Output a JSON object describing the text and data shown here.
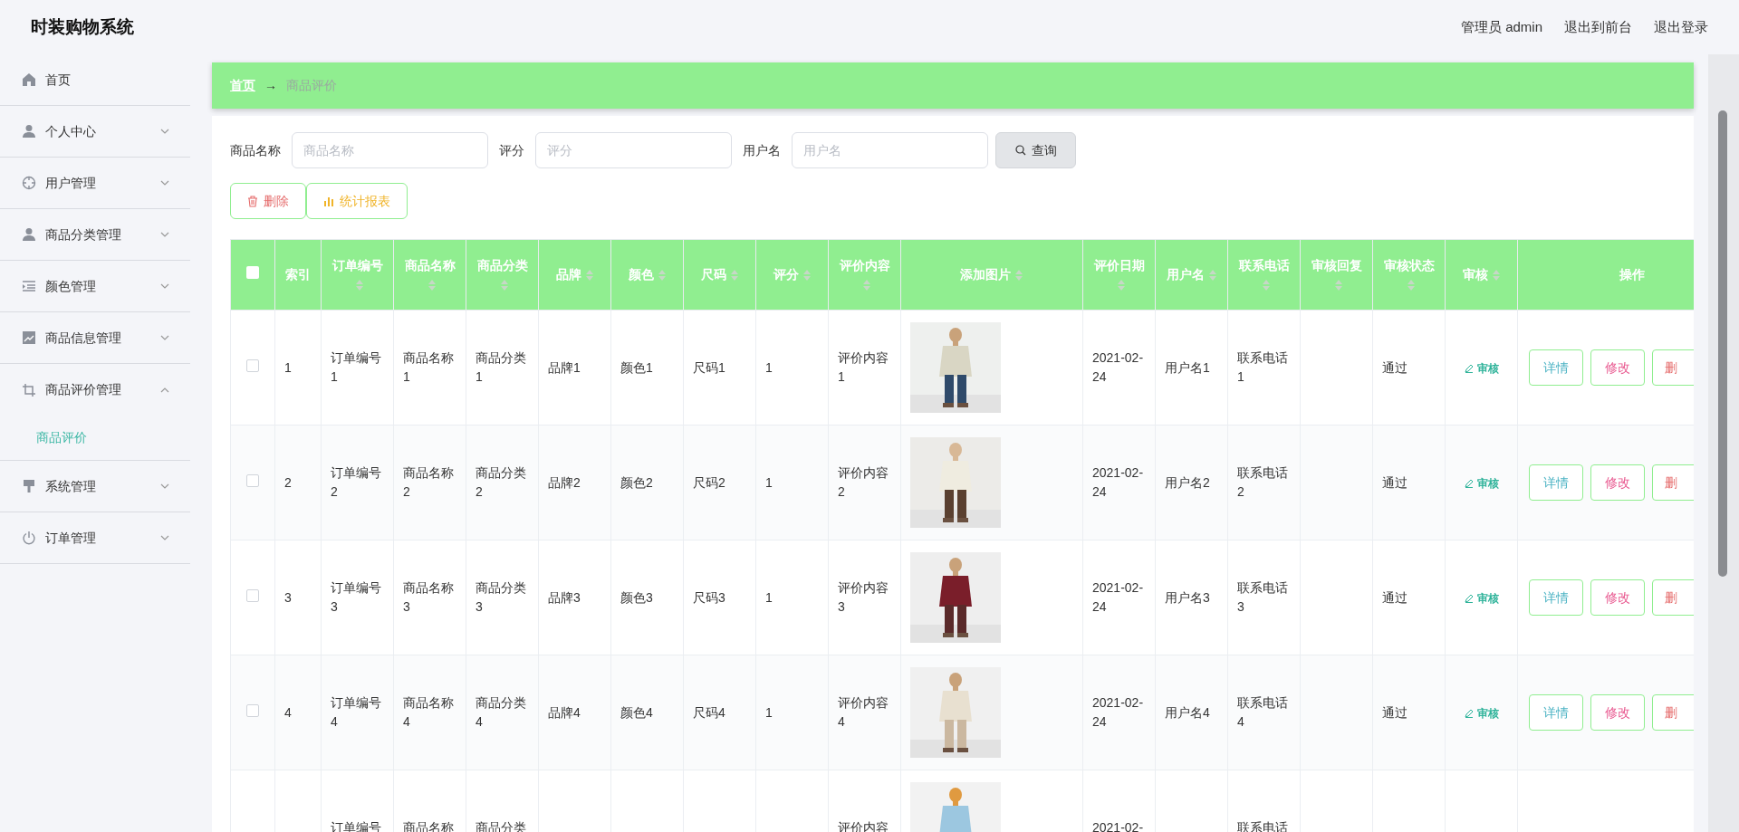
{
  "header": {
    "title": "时装购物系统",
    "links": [
      "管理员 admin",
      "退出到前台",
      "退出登录"
    ]
  },
  "sidebar": {
    "items": [
      {
        "label": "首页",
        "kind": "link"
      },
      {
        "label": "个人中心",
        "kind": "menu",
        "expanded": false
      },
      {
        "label": "用户管理",
        "kind": "menu",
        "expanded": false
      },
      {
        "label": "商品分类管理",
        "kind": "menu",
        "expanded": false
      },
      {
        "label": "颜色管理",
        "kind": "menu",
        "expanded": false
      },
      {
        "label": "商品信息管理",
        "kind": "menu",
        "expanded": false
      },
      {
        "label": "商品评价管理",
        "kind": "menu",
        "expanded": true,
        "children": [
          {
            "label": "商品评价",
            "selected": true
          }
        ]
      },
      {
        "label": "系统管理",
        "kind": "menu",
        "expanded": false
      },
      {
        "label": "订单管理",
        "kind": "menu",
        "expanded": false
      }
    ]
  },
  "breadcrumb": {
    "home": "首页",
    "separator": "→",
    "current": "商品评价"
  },
  "search": {
    "fields": [
      {
        "label": "商品名称",
        "placeholder": "商品名称"
      },
      {
        "label": "评分",
        "placeholder": "评分"
      },
      {
        "label": "用户名",
        "placeholder": "用户名"
      }
    ],
    "button": "查询"
  },
  "actions": [
    {
      "label": "删除",
      "kind": "delete"
    },
    {
      "label": "统计报表",
      "kind": "report"
    }
  ],
  "table": {
    "columns": [
      {
        "kind": "checkbox",
        "checked": false
      },
      {
        "label": "索引",
        "sortable": false
      },
      {
        "label": "订单编号",
        "sortable": true
      },
      {
        "label": "商品名称",
        "sortable": true
      },
      {
        "label": "商品分类",
        "sortable": true
      },
      {
        "label": "品牌",
        "sortable": true
      },
      {
        "label": "颜色",
        "sortable": true
      },
      {
        "label": "尺码",
        "sortable": true
      },
      {
        "label": "评分",
        "sortable": true
      },
      {
        "label": "评价内容",
        "sortable": true
      },
      {
        "label": "添加图片",
        "sortable": true
      },
      {
        "label": "评价日期",
        "sortable": true
      },
      {
        "label": "用户名",
        "sortable": true
      },
      {
        "label": "联系电话",
        "sortable": true
      },
      {
        "label": "审核回复",
        "sortable": true
      },
      {
        "label": "审核状态",
        "sortable": true
      },
      {
        "label": "审核",
        "sortable": true
      },
      {
        "label": "操作",
        "sortable": false
      }
    ],
    "rows": [
      {
        "cells": [
          {
            "kind": "checkbox",
            "checked": false
          },
          "1",
          "订单编号1",
          "商品名称1",
          "商品分类1",
          "品牌1",
          "颜色1",
          "尺码1",
          "1",
          "评价内容1",
          {
            "kind": "picture"
          },
          "2021-02-24",
          "用户名1",
          "联系电话1",
          null,
          "通过",
          {
            "kind": "link",
            "label": "审核"
          },
          {
            "kind": "buttons",
            "buttons": [
              "详情",
              "修改",
              "删"
            ]
          }
        ]
      },
      {
        "cells": [
          {
            "kind": "checkbox",
            "checked": false
          },
          "2",
          "订单编号2",
          "商品名称2",
          "商品分类2",
          "品牌2",
          "颜色2",
          "尺码2",
          "1",
          "评价内容2",
          {
            "kind": "picture"
          },
          "2021-02-24",
          "用户名2",
          "联系电话2",
          null,
          "通过",
          {
            "kind": "link",
            "label": "审核"
          },
          {
            "kind": "buttons",
            "buttons": [
              "详情",
              "修改",
              "删"
            ]
          }
        ]
      },
      {
        "cells": [
          {
            "kind": "checkbox",
            "checked": false
          },
          "3",
          "订单编号3",
          "商品名称3",
          "商品分类3",
          "品牌3",
          "颜色3",
          "尺码3",
          "1",
          "评价内容3",
          {
            "kind": "picture"
          },
          "2021-02-24",
          "用户名3",
          "联系电话3",
          null,
          "通过",
          {
            "kind": "link",
            "label": "审核"
          },
          {
            "kind": "buttons",
            "buttons": [
              "详情",
              "修改",
              "删"
            ]
          }
        ]
      },
      {
        "cells": [
          {
            "kind": "checkbox",
            "checked": false
          },
          "4",
          "订单编号4",
          "商品名称4",
          "商品分类4",
          "品牌4",
          "颜色4",
          "尺码4",
          "1",
          "评价内容4",
          {
            "kind": "picture"
          },
          "2021-02-24",
          "用户名4",
          "联系电话4",
          null,
          "通过",
          {
            "kind": "link",
            "label": "审核"
          },
          {
            "kind": "buttons",
            "buttons": [
              "详情",
              "修改",
              "删"
            ]
          }
        ]
      },
      {
        "cells": [
          null,
          null,
          "订单编号",
          "商品名称",
          "商品分类",
          null,
          null,
          null,
          null,
          "评价内容",
          {
            "kind": "picture"
          },
          "2021-02-",
          null,
          "联系电话",
          null,
          null,
          null,
          null
        ]
      }
    ]
  }
}
